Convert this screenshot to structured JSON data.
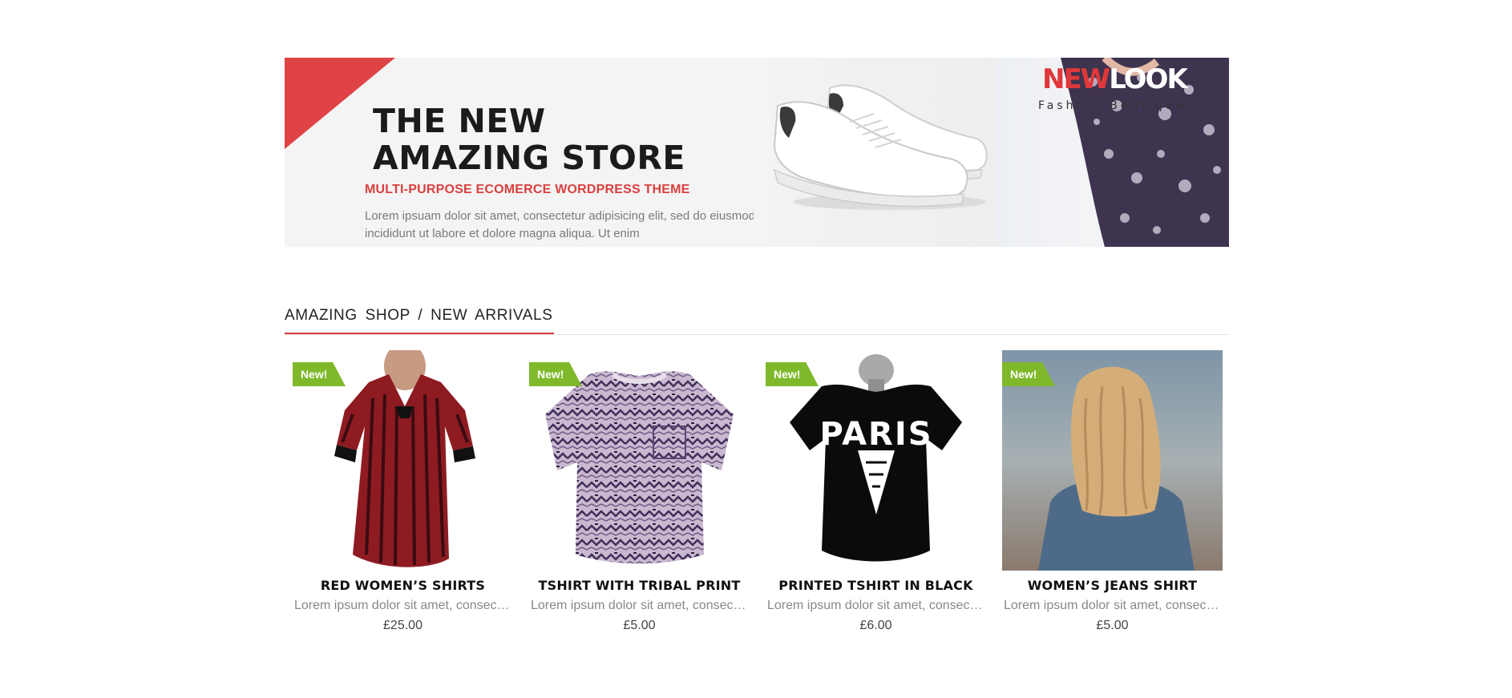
{
  "banner": {
    "title": "THE NEW\nAMAZING STORE",
    "subtitle": "MULTI-PURPOSE ECOMERCE WORDPRESS THEME",
    "description": "Lorem ipsuam dolor sit amet, consectetur adipisicing elit, sed do eiusmod tempor incididunt ut labore et dolore magna aliqua. Ut enim",
    "logo_new": "NEW",
    "logo_look": "LOOK",
    "logo_tagline": "Fashion Boutique",
    "accent_color": "#e04345"
  },
  "section": {
    "title": "AMAZING SHOP / NEW ARRIVALS"
  },
  "products": [
    {
      "badge": "New!",
      "name": "RED WOMEN’S SHIRTS",
      "description": "Lorem ipsum dolor sit amet, consectetur adipiscing elit",
      "price": "£25.00",
      "image_icon": "red-striped-coat-image"
    },
    {
      "badge": "New!",
      "name": "TSHIRT WITH TRIBAL PRINT",
      "description": "Lorem ipsum dolor sit amet, consectetur adipiscing elit",
      "price": "£5.00",
      "image_icon": "tribal-print-tshirt-image"
    },
    {
      "badge": "New!",
      "name": "PRINTED TSHIRT IN BLACK",
      "description": "Lorem ipsum dolor sit amet, consectetur adipiscing elit",
      "price": "£6.00",
      "image_icon": "black-paris-tshirt-image"
    },
    {
      "badge": "New!",
      "name": "WOMEN’S JEANS SHIRT",
      "description": "Lorem ipsum dolor sit amet, consectetur adipiscing elit",
      "price": "£5.00",
      "image_icon": "woman-jeans-shirt-photo"
    }
  ],
  "colors": {
    "badge_green": "#7fb92b",
    "accent_red": "#d8403f"
  }
}
